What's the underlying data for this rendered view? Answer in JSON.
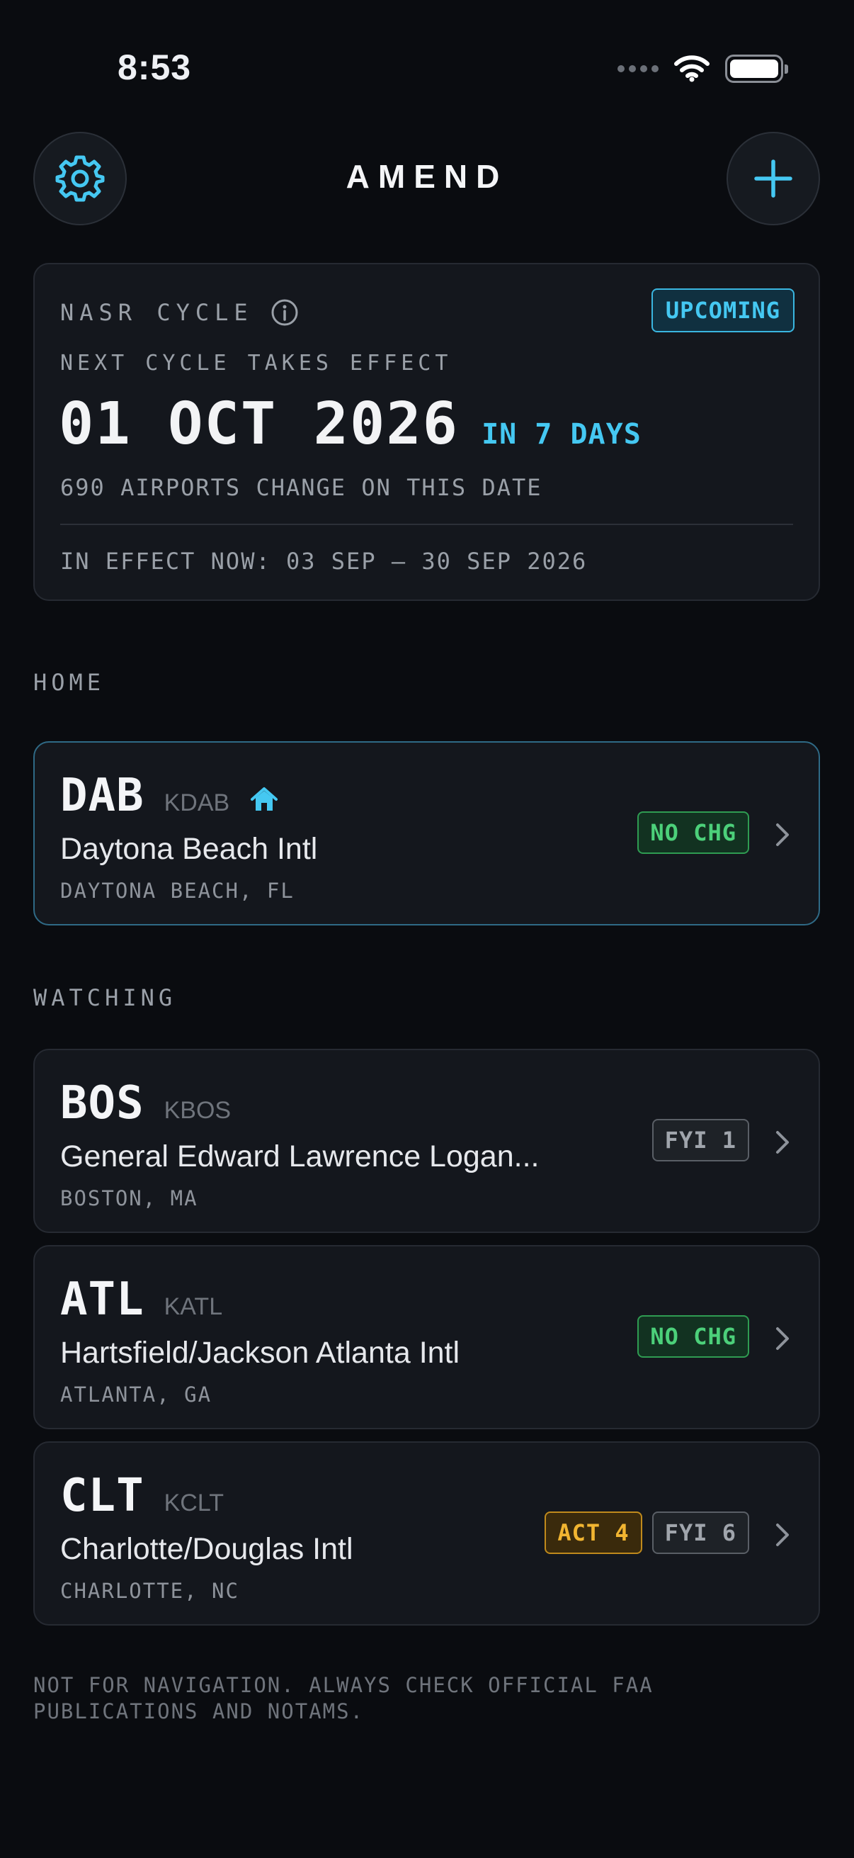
{
  "status_bar": {
    "time": "8:53"
  },
  "header": {
    "title": "AMEND"
  },
  "cycle": {
    "label": "NASR CYCLE",
    "badge": "UPCOMING",
    "next_label": "NEXT CYCLE TAKES EFFECT",
    "date": "01 OCT 2026",
    "days": "IN 7 DAYS",
    "airports_change": "690 AIRPORTS CHANGE ON THIS DATE",
    "in_effect": "IN EFFECT NOW: 03 SEP — 30 SEP 2026"
  },
  "sections": {
    "home": "HOME",
    "watching": "WATCHING"
  },
  "home_airport": {
    "iata": "DAB",
    "icao": "KDAB",
    "name": "Daytona Beach Intl",
    "city": "DAYTONA BEACH, FL",
    "badges": [
      "NO CHG"
    ]
  },
  "watching": [
    {
      "iata": "BOS",
      "icao": "KBOS",
      "name": "General Edward Lawrence Logan...",
      "city": "BOSTON, MA",
      "badges": [
        "FYI 1"
      ]
    },
    {
      "iata": "ATL",
      "icao": "KATL",
      "name": "Hartsfield/Jackson Atlanta Intl",
      "city": "ATLANTA, GA",
      "badges": [
        "NO CHG"
      ]
    },
    {
      "iata": "CLT",
      "icao": "KCLT",
      "name": "Charlotte/Douglas Intl",
      "city": "CHARLOTTE, NC",
      "badges": [
        "ACT 4",
        "FYI 6"
      ]
    }
  ],
  "disclaimer": "NOT FOR NAVIGATION. ALWAYS CHECK OFFICIAL FAA PUBLICATIONS AND NOTAMS.",
  "colors": {
    "accent": "#45c8f2",
    "no_change": "#4cd07a",
    "action": "#f2b531",
    "fyi": "#a0a5ac",
    "background": "#0a0c10"
  }
}
